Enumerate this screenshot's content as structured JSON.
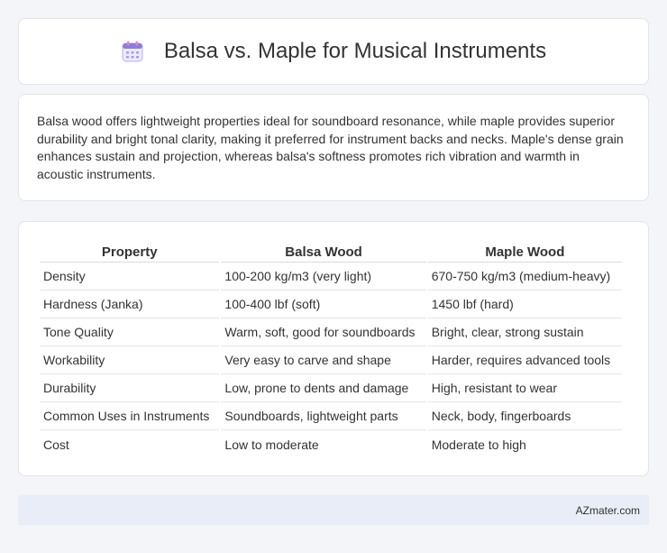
{
  "header": {
    "title": "Balsa vs. Maple for Musical Instruments",
    "icon": "calendar-icon"
  },
  "summary": {
    "text": "Balsa wood offers lightweight properties ideal for soundboard resonance, while maple provides superior durability and bright tonal clarity, making it preferred for instrument backs and necks. Maple's dense grain enhances sustain and projection, whereas balsa's softness promotes rich vibration and warmth in acoustic instruments."
  },
  "table": {
    "headers": [
      "Property",
      "Balsa Wood",
      "Maple Wood"
    ],
    "rows": [
      [
        "Density",
        "100-200 kg/m3 (very light)",
        "670-750 kg/m3 (medium-heavy)"
      ],
      [
        "Hardness (Janka)",
        "100-400 lbf (soft)",
        "1450 lbf (hard)"
      ],
      [
        "Tone Quality",
        "Warm, soft, good for soundboards",
        "Bright, clear, strong sustain"
      ],
      [
        "Workability",
        "Very easy to carve and shape",
        "Harder, requires advanced tools"
      ],
      [
        "Durability",
        "Low, prone to dents and damage",
        "High, resistant to wear"
      ],
      [
        "Common Uses in Instruments",
        "Soundboards, lightweight parts",
        "Neck, body, fingerboards"
      ],
      [
        "Cost",
        "Low to moderate",
        "Moderate to high"
      ]
    ]
  },
  "footer": {
    "brand": "AZmater.com"
  },
  "colors": {
    "page_bg": "#f4f5f9",
    "card_bg": "#ffffff",
    "footer_bg": "#e8edf7",
    "icon_purple": "#8b7fd6",
    "icon_pink": "#e98bb3"
  }
}
